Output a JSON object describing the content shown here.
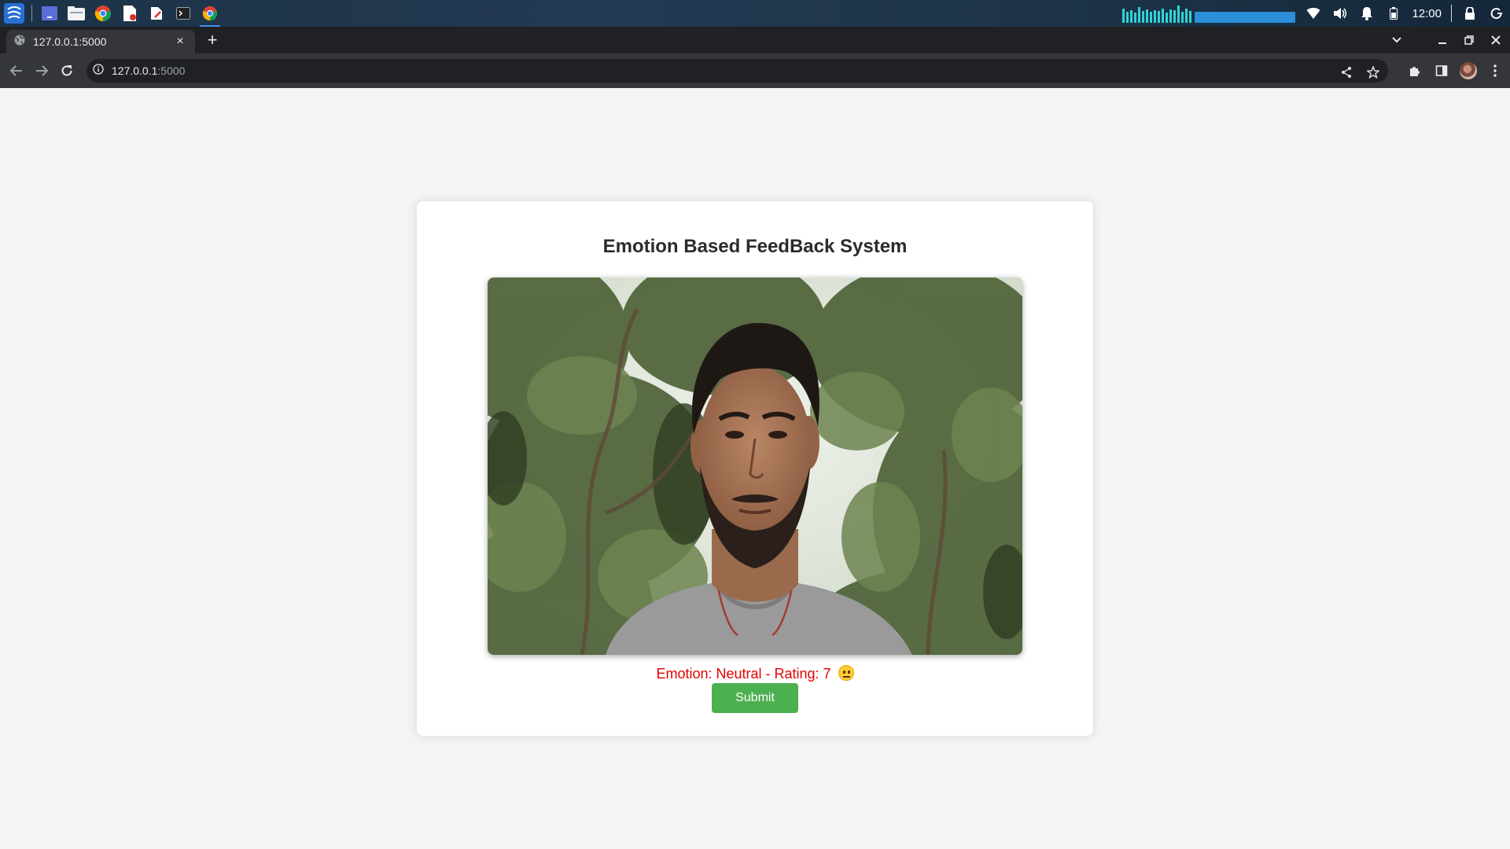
{
  "os": {
    "clock": "12:00",
    "apps": [
      "launcher-icon",
      "workspace-icon",
      "file-manager-icon",
      "chrome-icon",
      "pdf-icon",
      "document-icon",
      "terminal-icon",
      "chrome-active-icon"
    ],
    "tray": [
      "audio-visualizer",
      "wifi-icon",
      "volume-icon",
      "bell-icon",
      "battery-icon",
      "lock-icon",
      "power-icon"
    ]
  },
  "browser": {
    "tab": {
      "title": "127.0.0.1:5000",
      "close_glyph": "×"
    },
    "new_tab_glyph": "+",
    "url": {
      "host": "127.0.0.1",
      "port": ":5000"
    }
  },
  "page": {
    "title": "Emotion Based FeedBack System",
    "status": "Emotion: Neutral - Rating: 7",
    "status_emoji": "neutral-face-emoji",
    "submit_label": "Submit",
    "status_color": "#e00000",
    "button_color": "#4caf50"
  }
}
